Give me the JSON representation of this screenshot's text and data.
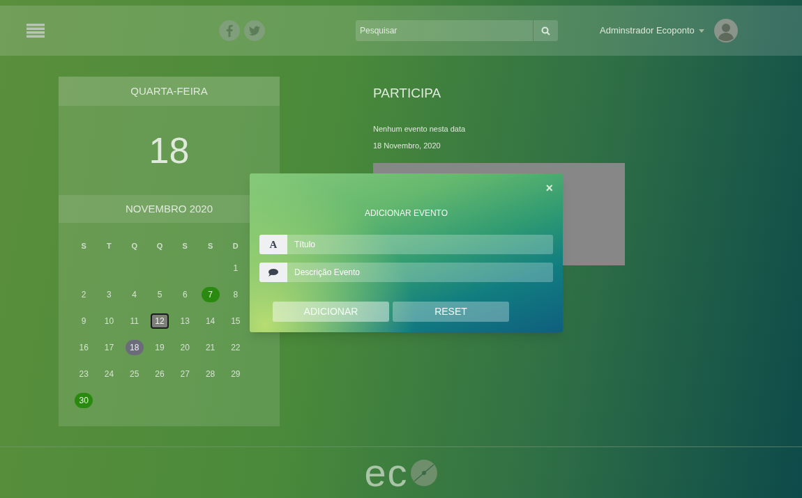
{
  "header": {
    "search": {
      "placeholder": "Pesquisar"
    },
    "user": "Adminstrador Ecoponto"
  },
  "calendar": {
    "weekday": "QUARTA-FEIRA",
    "day": "18",
    "month": "NOVEMBRO 2020",
    "weekdays": [
      "S",
      "T",
      "Q",
      "Q",
      "S",
      "S",
      "D"
    ],
    "weeks": [
      [
        {
          "kind": "empty"
        },
        {
          "kind": "empty"
        },
        {
          "kind": "empty"
        },
        {
          "kind": "empty"
        },
        {
          "kind": "empty"
        },
        {
          "kind": "empty"
        },
        {
          "label": "1",
          "kind": "normal"
        }
      ],
      [
        {
          "label": "2",
          "kind": "normal"
        },
        {
          "label": "3",
          "kind": "normal"
        },
        {
          "label": "4",
          "kind": "normal"
        },
        {
          "label": "5",
          "kind": "normal"
        },
        {
          "label": "6",
          "kind": "normal"
        },
        {
          "label": "7",
          "kind": "event"
        },
        {
          "label": "8",
          "kind": "normal"
        }
      ],
      [
        {
          "label": "9",
          "kind": "normal"
        },
        {
          "label": "10",
          "kind": "normal"
        },
        {
          "label": "11",
          "kind": "normal"
        },
        {
          "label": "12",
          "kind": "focused"
        },
        {
          "label": "13",
          "kind": "normal"
        },
        {
          "label": "14",
          "kind": "normal"
        },
        {
          "label": "15",
          "kind": "normal"
        }
      ],
      [
        {
          "label": "16",
          "kind": "normal"
        },
        {
          "label": "17",
          "kind": "normal"
        },
        {
          "label": "18",
          "kind": "today"
        },
        {
          "label": "19",
          "kind": "normal"
        },
        {
          "label": "20",
          "kind": "normal"
        },
        {
          "label": "21",
          "kind": "normal"
        },
        {
          "label": "22",
          "kind": "normal"
        }
      ],
      [
        {
          "label": "23",
          "kind": "normal"
        },
        {
          "label": "24",
          "kind": "normal"
        },
        {
          "label": "25",
          "kind": "normal"
        },
        {
          "label": "26",
          "kind": "normal"
        },
        {
          "label": "27",
          "kind": "normal"
        },
        {
          "label": "28",
          "kind": "normal"
        },
        {
          "label": "29",
          "kind": "normal"
        }
      ],
      [
        {
          "label": "30",
          "kind": "event"
        }
      ]
    ]
  },
  "events": {
    "title": "PARTICIPA",
    "message": "Nenhum evento nesta data",
    "date": "18 Novembro, 2020"
  },
  "footer": {
    "logo": "ec"
  },
  "modal": {
    "close": "×",
    "title": "ADICIONAR EVENTO",
    "fields": [
      {
        "kind": "title",
        "icon": "A",
        "placeholder": "Título"
      },
      {
        "kind": "description",
        "placeholder": "Descrição Evento"
      }
    ],
    "buttons": [
      "ADICIONAR",
      "RESET"
    ]
  }
}
